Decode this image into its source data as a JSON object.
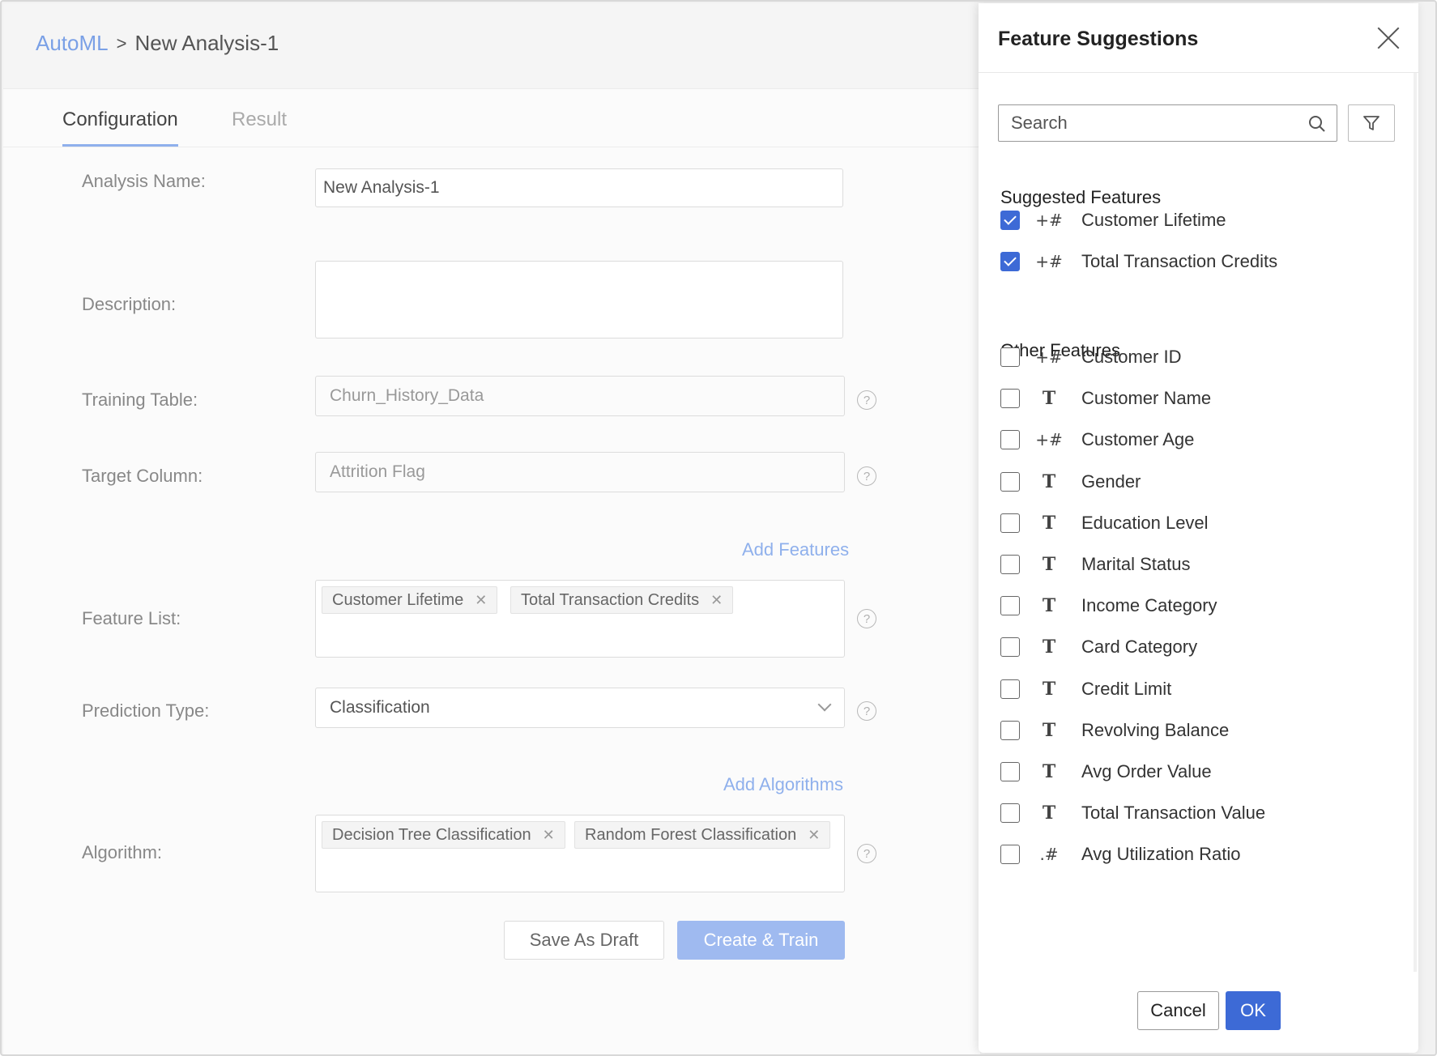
{
  "breadcrumb": {
    "parent": "AutoML",
    "separator": ">",
    "current": "New Analysis-1"
  },
  "tabs": [
    {
      "label": "Configuration",
      "active": true
    },
    {
      "label": "Result",
      "active": false
    }
  ],
  "form": {
    "analysis_name": {
      "label": "Analysis Name:",
      "value": "New Analysis-1"
    },
    "description": {
      "label": "Description:",
      "value": ""
    },
    "training_table": {
      "label": "Training Table:",
      "value": "Churn_History_Data"
    },
    "target_column": {
      "label": "Target Column:",
      "value": "Attrition Flag"
    },
    "add_features_link": "Add Features",
    "feature_list": {
      "label": "Feature List:",
      "tags": [
        "Customer Lifetime",
        "Total Transaction Credits"
      ]
    },
    "prediction_type": {
      "label": "Prediction Type:",
      "value": "Classification"
    },
    "add_algorithms_link": "Add Algorithms",
    "algorithm": {
      "label": "Algorithm:",
      "tags": [
        "Decision Tree Classification",
        "Random Forest Classification"
      ]
    },
    "help_glyph": "?",
    "tag_remove_glyph": "✕"
  },
  "actions": {
    "save_draft": "Save As Draft",
    "create_train": "Create & Train"
  },
  "panel": {
    "title": "Feature Suggestions",
    "search_placeholder": "Search",
    "suggested_title": "Suggested Features",
    "other_title": "Other Features",
    "suggested": [
      {
        "label": "Customer Lifetime",
        "type": "+#",
        "checked": true
      },
      {
        "label": "Total Transaction Credits",
        "type": "+#",
        "checked": true
      }
    ],
    "other": [
      {
        "label": "Customer ID",
        "type": "+#",
        "checked": false
      },
      {
        "label": "Customer Name",
        "type": "T",
        "checked": false
      },
      {
        "label": "Customer Age",
        "type": "+#",
        "checked": false
      },
      {
        "label": "Gender",
        "type": "T",
        "checked": false
      },
      {
        "label": "Education Level",
        "type": "T",
        "checked": false
      },
      {
        "label": "Marital Status",
        "type": "T",
        "checked": false
      },
      {
        "label": "Income Category",
        "type": "T",
        "checked": false
      },
      {
        "label": "Card Category",
        "type": "T",
        "checked": false
      },
      {
        "label": "Credit Limit",
        "type": "T",
        "checked": false
      },
      {
        "label": "Revolving Balance",
        "type": "T",
        "checked": false
      },
      {
        "label": "Avg Order Value",
        "type": "T",
        "checked": false
      },
      {
        "label": "Total Transaction Value",
        "type": "T",
        "checked": false
      },
      {
        "label": "Avg Utilization Ratio",
        "type": ".#",
        "checked": false
      }
    ],
    "cancel": "Cancel",
    "ok": "OK"
  },
  "colors": {
    "accent": "#3d6ad6",
    "link": "#8fb0ec",
    "primary_disabled": "#9fbaf0"
  }
}
